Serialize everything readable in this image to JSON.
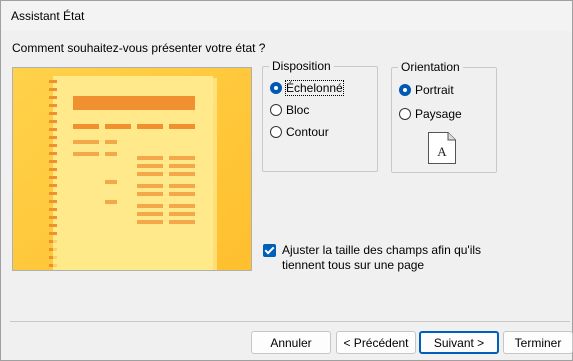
{
  "window": {
    "title": "Assistant État"
  },
  "prompt": "Comment souhaitez-vous présenter votre état ?",
  "layout_group": {
    "legend": "Disposition",
    "options": [
      {
        "label": "Échelonné",
        "selected": true
      },
      {
        "label": "Bloc",
        "selected": false
      },
      {
        "label": "Contour",
        "selected": false
      }
    ]
  },
  "orientation_group": {
    "legend": "Orientation",
    "options": [
      {
        "label": "Portrait",
        "selected": true
      },
      {
        "label": "Paysage",
        "selected": false
      }
    ],
    "page_icon_letter": "A"
  },
  "fit_fields": {
    "label": "Ajuster la taille des champs afin qu'ils tiennent tous sur une page",
    "checked": true
  },
  "buttons": {
    "cancel": "Annuler",
    "previous": "< Précédent",
    "next": "Suivant >",
    "finish": "Terminer"
  },
  "colors": {
    "accent": "#0059b3",
    "preview_bg": "#ffc83d",
    "preview_bar": "#f0902e"
  }
}
